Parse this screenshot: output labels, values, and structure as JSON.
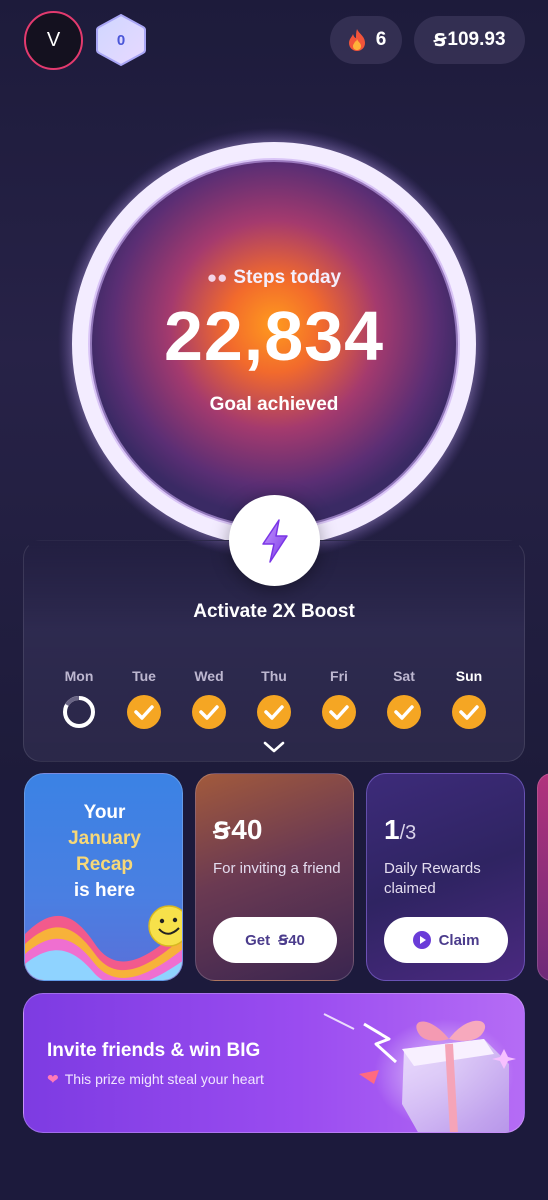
{
  "header": {
    "avatar_initial": "V",
    "level": "0",
    "streak_count": "6",
    "balance": "109.93",
    "coin_symbol": "Ꞩ"
  },
  "steps": {
    "label": "Steps today",
    "value": "22,834",
    "status": "Goal achieved"
  },
  "boost": {
    "label": "Activate 2X Boost"
  },
  "week": {
    "days": [
      {
        "name": "Mon",
        "state": "in-progress",
        "today": false
      },
      {
        "name": "Tue",
        "state": "done",
        "today": false
      },
      {
        "name": "Wed",
        "state": "done",
        "today": false
      },
      {
        "name": "Thu",
        "state": "done",
        "today": false
      },
      {
        "name": "Fri",
        "state": "done",
        "today": false
      },
      {
        "name": "Sat",
        "state": "done",
        "today": false
      },
      {
        "name": "Sun",
        "state": "done",
        "today": true
      }
    ]
  },
  "cards": {
    "recap": {
      "line1": "Your",
      "line2": "January",
      "line3": "Recap",
      "line4": "is here"
    },
    "invite": {
      "amount": "40",
      "description": "For inviting a friend",
      "button_label": "Get",
      "button_amount": "40"
    },
    "daily": {
      "claimed": "1",
      "total": "/3",
      "description": "Daily Rewards claimed",
      "button_label": "Claim"
    }
  },
  "banner": {
    "title": "Invite friends & win BIG",
    "subtitle": "This prize might steal your heart"
  },
  "colors": {
    "background": "#1c1a3c",
    "accent_orange": "#f5a623",
    "banner_purple": "#9a4cf0",
    "avatar_ring": "#e33a6e"
  }
}
